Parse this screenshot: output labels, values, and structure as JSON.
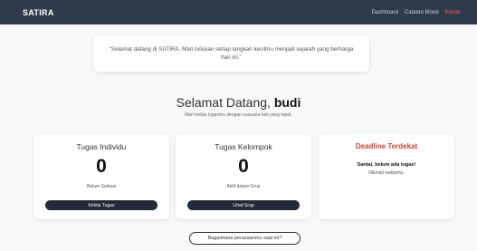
{
  "navbar": {
    "brand": "SATIRA",
    "links": [
      {
        "label": "Dashboard"
      },
      {
        "label": "Catatan Mood"
      },
      {
        "label": "Keluar"
      }
    ]
  },
  "quote": {
    "text": "\"Selamat datang di SATIRA. Mari tuliskan setiap langkah kecilmu menjadi sejarah yang berharga hari ini.\""
  },
  "welcome": {
    "greeting": "Selamat Datang,",
    "username": "budi",
    "subtitle": "Mari kelola tugasmu dengan suasana hati yang tepat."
  },
  "cards": {
    "individual": {
      "title": "Tugas Individu",
      "count": "0",
      "caption": "Belum Selesai",
      "button": "Kelola Tugas"
    },
    "group": {
      "title": "Tugas Kelompok",
      "count": "0",
      "caption": "Aktif dalam Grup",
      "button": "Lihat Grup"
    },
    "deadline": {
      "title": "Deadline Terdekat",
      "empty_title": "Santai, belum ada tugas!",
      "empty_note": "Nikmati waktumu."
    }
  },
  "mood": {
    "button": "Bagaimana perasaanmu saat ini?"
  },
  "colors": {
    "navbar": "#2f3a4b",
    "accent_red": "#d93a32",
    "button_dark": "#232b38"
  }
}
